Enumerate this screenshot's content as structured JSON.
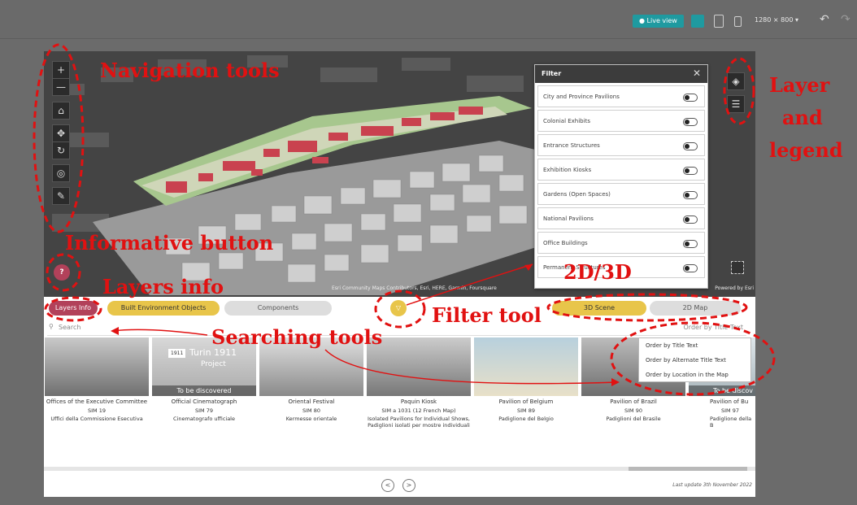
{
  "toolbar": {
    "live_view": "● Live view",
    "resolution": "1280 × 800 ▾",
    "undo_icon": "↶",
    "redo_icon": "↷"
  },
  "map": {
    "attribution": "Esri Community Maps Contributors, Esri, HERE, Garmin, Foursquare",
    "powered_by": "Powered by Esri",
    "help_button": "?"
  },
  "map_tools": [
    "+",
    "—",
    "⌂",
    "✥",
    "↻",
    "◎",
    "✎"
  ],
  "layer_tools": [
    "◈",
    "☰"
  ],
  "filter": {
    "title": "Filter",
    "items": [
      "City and Province Pavilions",
      "Colonial Exhibits",
      "Entrance Structures",
      "Exhibition Kiosks",
      "Gardens (Open Spaces)",
      "National Pavilions",
      "Office Buildings",
      "Permanent Structures"
    ]
  },
  "tabs": {
    "layers_info": "Layers Info",
    "built_env": "Built Environment Objects",
    "components": "Components",
    "filter_icon": "▽",
    "scene_3d": "3D Scene",
    "map_2d": "2D Map"
  },
  "search": {
    "placeholder": "Search",
    "order": "Order by Title Text"
  },
  "order_menu": [
    "Order by Title Text",
    "Order by Alternate Title Text",
    "Order by Location in the Map"
  ],
  "cards": [
    {
      "title": "Offices of the Executive Committee",
      "sim": "SIM 19",
      "alt": "Uffici della Commissione Esecutiva",
      "overlay": ""
    },
    {
      "title": "Official Cinematograph",
      "sim": "SIM 79",
      "alt": "Cinematografo ufficiale",
      "overlay": "To be discovered"
    },
    {
      "title": "Oriental Festival",
      "sim": "SIM 80",
      "alt": "Kermesse orientale",
      "overlay": ""
    },
    {
      "title": "Paquin Kiosk",
      "sim": "SIM a 1031 (12 French Map)",
      "alt": "Isolated Pavilions for Individual Shows, Padiglioni isolati per mostre individuali",
      "overlay": ""
    },
    {
      "title": "Pavilion of Belgium",
      "sim": "SIM 89",
      "alt": "Padiglione del Belgio",
      "overlay": ""
    },
    {
      "title": "Pavilion of Brazil",
      "sim": "SIM 90",
      "alt": "Padiglioni del Brasile",
      "overlay": ""
    },
    {
      "title": "Pavilion of Bu",
      "sim": "SIM 97",
      "alt": "Padiglione della B",
      "overlay": "To be discov"
    }
  ],
  "thumb_text": {
    "turin": "Turin 1911",
    "project": "Project",
    "year": "1911"
  },
  "footer": {
    "prev": "<",
    "next": ">",
    "updated": "Last update 3th November 2022"
  },
  "annotations": {
    "nav": "Navigation tools",
    "layer1": "Layer",
    "layer2": "and",
    "layer3": "legend",
    "info_btn": "Informative button",
    "layers_info": "Layers info",
    "dim": "2D/3D",
    "filter": "Filter tool",
    "searching": "Searching tools"
  },
  "colors": {
    "accent": "#1f9aa0",
    "layers_info": "#b2415a",
    "built_env": "#e8c54a",
    "annotation": "#e11111"
  }
}
